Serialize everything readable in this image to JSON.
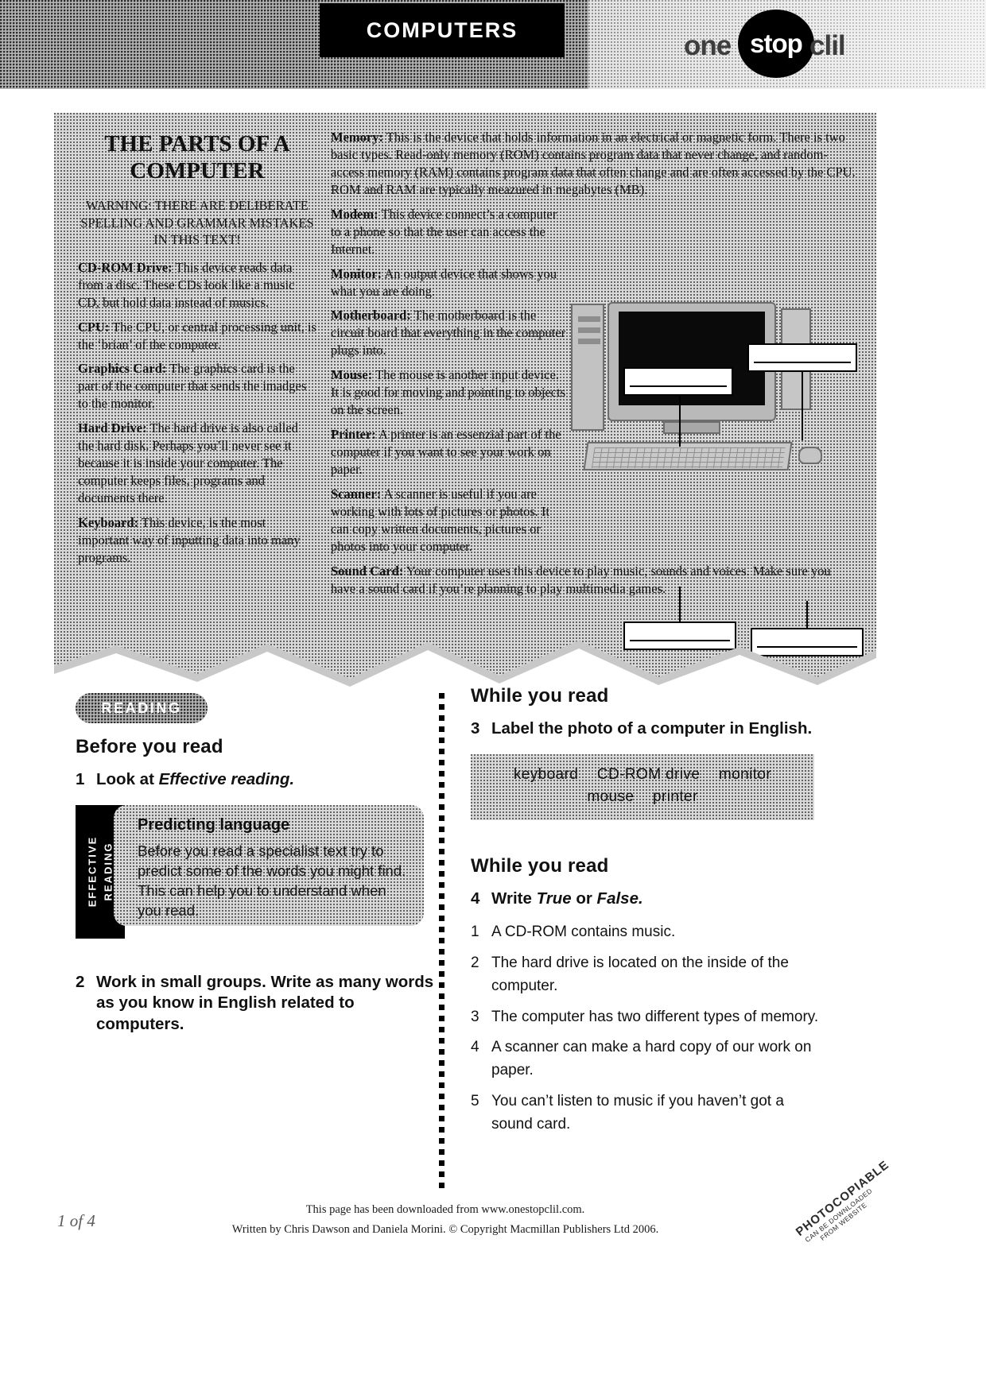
{
  "header": {
    "topic_label": "COMPUTERS",
    "logo": {
      "part1": "one",
      "part2": "stop",
      "part3": "clil"
    }
  },
  "article": {
    "title": "THE PARTS OF A COMPUTER",
    "warning": "WARNING: THERE ARE DELIBERATE SPELLING AND GRAMMAR MISTAKES IN THIS TEXT!",
    "left_entries": [
      {
        "term": "CD-ROM Drive:",
        "text": " This device reads data from a disc. These CDs look like a music CD, but hold data instead of musics."
      },
      {
        "term": "CPU:",
        "text": " The CPU, or central processing unit, is the ‘brian’ of the computer."
      },
      {
        "term": "Graphics Card:",
        "text": " The graphics card is the part of the computer that sends the imadges to the monitor."
      },
      {
        "term": "Hard Drive:",
        "text": " The hard drive is also called the hard disk. Perhaps you’ll never see it because it is inside your computer. The computer keeps files, programs and documents there."
      },
      {
        "term": "Keyboard:",
        "text": " This device, is the most important way of inputting data into many programs."
      }
    ],
    "right_entries": [
      {
        "term": "Memory:",
        "text": " This is the device that holds information in an electrical or magnetic form. There is two basic types. Read-only memory (ROM) contains program data that never change, and random-access memory (RAM) contains program data that often change and are often accessed by the CPU. ROM and RAM are typically meazured in megabytes (MB).",
        "wide": true
      },
      {
        "term": "Modem:",
        "text": " This device connect’s a computer to a phone so that the user can access the Internet.",
        "wide": false
      },
      {
        "term": "Monitor:",
        "text": " An output device that shows you what you are doing.",
        "wide": false
      },
      {
        "term": "Motherboard:",
        "text": " The motherboard is the circuit board that everything in the computer plugs into.",
        "wide": false
      },
      {
        "term": "Mouse:",
        "text": " The mouse is another input device. It is good for moving and pointing to objects on the screen.",
        "wide": false
      },
      {
        "term": "Printer:",
        "text": " A printer is an essenzial part of the computer if you want to see your work on paper.",
        "wide": false
      },
      {
        "term": "Scanner:",
        "text": " A scanner is useful if you are working with lots of pictures or photos. It can copy written documents, pictures or photos into your computer.",
        "wide": false
      },
      {
        "term": "Sound Card:",
        "text": " Your computer uses this device to play music, sounds and voices. Make sure you have a sound card if you’re planning to play multimedia games.",
        "wide": true
      }
    ]
  },
  "worksheet": {
    "reading_pill": "READING",
    "before_heading": "Before you read",
    "task1": {
      "number": "1",
      "text_plain": "Look at ",
      "text_italic": "Effective reading."
    },
    "effective": {
      "tab_line1": "EFFECTIVE",
      "tab_line2": "READING",
      "title": "Predicting language",
      "text": "Before you read a specialist text try to predict some of the words you might find. This can help you to understand when you read."
    },
    "task2": {
      "number": "2",
      "text": "Work in small groups. Write as many words as you know in English related to computers."
    },
    "while_heading_1": "While you read",
    "task3": {
      "number": "3",
      "text": "Label the photo of a computer in English."
    },
    "wordbank": {
      "line1": [
        "keyboard",
        "CD-ROM drive",
        "monitor"
      ],
      "line2": [
        "mouse",
        "printer"
      ]
    },
    "while_heading_2": "While you read",
    "task4": {
      "number": "4",
      "text_plain_1": "Write ",
      "text_italic_1": "True",
      "text_plain_2": " or ",
      "text_italic_2": "False."
    },
    "true_false_items": [
      {
        "number": "1",
        "text": "A CD-ROM contains music."
      },
      {
        "number": "2",
        "text": "The hard drive is located on the inside of the computer."
      },
      {
        "number": "3",
        "text": "The computer has two different types of memory."
      },
      {
        "number": "4",
        "text": "A scanner can make a hard copy of our work on paper."
      },
      {
        "number": "5",
        "text": "You can’t listen to music if you haven’t got a sound card."
      }
    ]
  },
  "footer": {
    "page_marker": "1 of 4",
    "line1": "This page has been downloaded from www.onestopclil.com.",
    "line2": "Written by Chris Dawson and Daniela Morini. © Copyright Macmillan Publishers Ltd 2006.",
    "stamp_line1": "PHOTOCOPIABLE",
    "stamp_line2": "CAN BE DOWNLOADED",
    "stamp_line3": "FROM WEBSITE"
  },
  "colors": {
    "ink": "#111111",
    "paper": "#ffffff",
    "panel_gray": "#d9d9d9",
    "black": "#000000"
  }
}
